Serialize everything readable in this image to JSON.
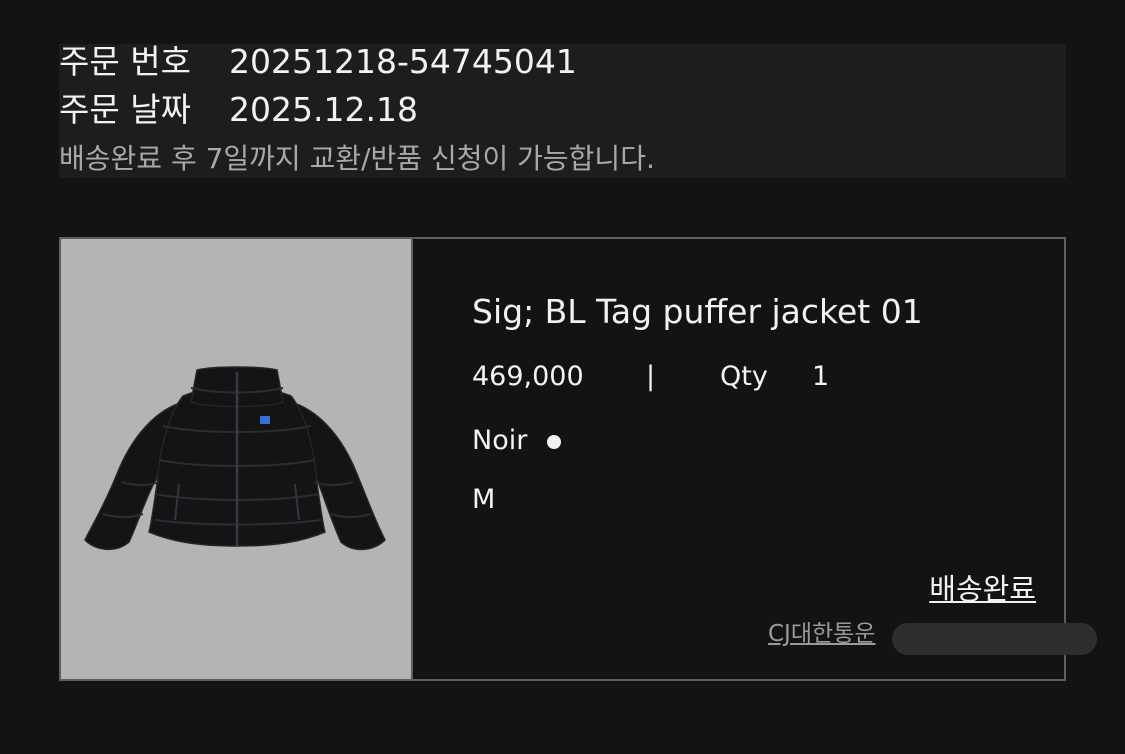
{
  "order": {
    "number_label": "주문 번호",
    "number_value": "20251218-54745041",
    "date_label": "주문 날짜",
    "date_value": "2025.12.18",
    "notice": "배송완료 후 7일까지 교환/반품 신청이 가능합니다."
  },
  "product": {
    "name": "Sig; BL Tag puffer jacket 01",
    "price": "469,000",
    "separator": "|",
    "qty_label": "Qty",
    "qty_value": "1",
    "color_name": "Noir",
    "size": "M",
    "image_icon": "puffer-jacket-icon"
  },
  "shipping": {
    "status": "배송완료",
    "carrier": "CJ대한통운"
  },
  "colors": {
    "background": "#131313",
    "panel": "#1d1d1d",
    "border": "#5e5e5e",
    "image_bg": "#b4b4b4",
    "text": "#f2f2f2",
    "muted": "#a9a9a9"
  }
}
